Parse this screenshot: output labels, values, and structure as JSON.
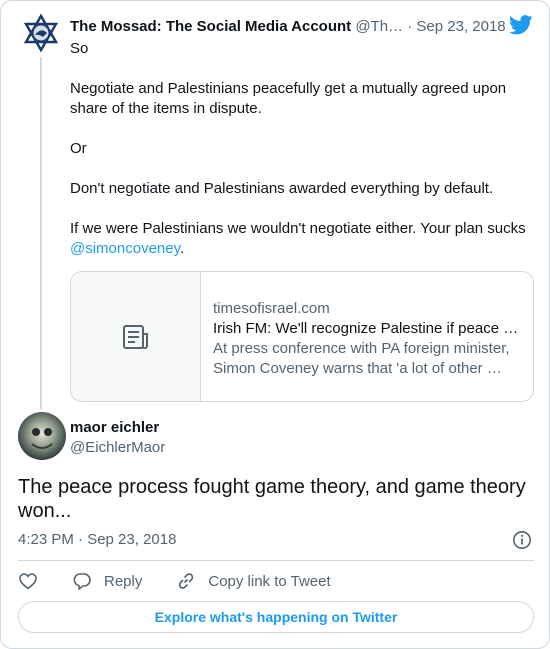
{
  "quoted_tweet": {
    "display_name": "The Mossad: The Social Media Account",
    "handle": "@Th…",
    "separator": " · ",
    "date": "Sep 23, 2018",
    "paragraphs": [
      "So",
      "Negotiate and Palestinians peacefully get a mutually agreed upon share of the items in dispute.",
      "Or",
      "Don't negotiate and Palestinians awarded everything by default."
    ],
    "last_paragraph_text": "If we were Palestinians we wouldn't negotiate either. Your plan sucks ",
    "mention": "@simoncoveney",
    "mention_suffix": ".",
    "link_card": {
      "domain": "timesofisrael.com",
      "title": "Irish FM: We'll recognize Palestine if peace …",
      "description": "At press conference with PA foreign minister, Simon Coveney warns that 'a lot of other …"
    }
  },
  "tweet": {
    "display_name": "maor eichler",
    "handle": "@EichlerMaor",
    "text": "The peace process fought game theory, and game theory won...",
    "timestamp": "4:23 PM · Sep 23, 2018"
  },
  "actions": {
    "reply_label": "Reply",
    "copy_link_label": "Copy link to Tweet"
  },
  "explore_label": "Explore what's happening on Twitter",
  "colors": {
    "accent": "#1d9bf0",
    "text": "#0f1419",
    "secondary": "#536471",
    "border": "#cfd9de"
  },
  "icons": [
    "twitter-bird-icon",
    "article-icon",
    "info-icon",
    "heart-icon",
    "reply-icon",
    "link-icon"
  ]
}
